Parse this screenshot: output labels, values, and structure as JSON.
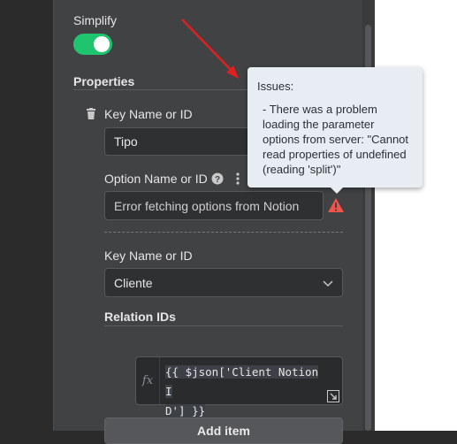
{
  "panel": {
    "simplify_label": "Simplify",
    "simplify_on": true,
    "properties_heading": "Properties",
    "key_name_label_1": "Key Name or ID",
    "key_value_1": "Tipo",
    "option_name_label": "Option Name or ID",
    "option_error_value": "Error fetching options from Notion",
    "key_name_label_2": "Key Name or ID",
    "key_value_2": "Cliente",
    "relation_ids_label": "Relation IDs",
    "expression_fx": "fx",
    "expression_line1": "{{ $json['Client Notion I",
    "expression_line2": "D'] }}",
    "add_item_label": "Add item"
  },
  "tooltip": {
    "title": "Issues:",
    "message": "- There was a problem loading the parameter options from server: \"Cannot read properties of undefined (reading 'split')\""
  },
  "colors": {
    "toggle_on": "#1fc46e",
    "warning": "#f0534c",
    "annotation_arrow": "#e02020",
    "panel_bg": "#414244"
  },
  "icons": [
    "trash-icon",
    "help-icon",
    "dots-menu-icon",
    "warning-icon",
    "chevron-down-icon",
    "expand-icon"
  ]
}
